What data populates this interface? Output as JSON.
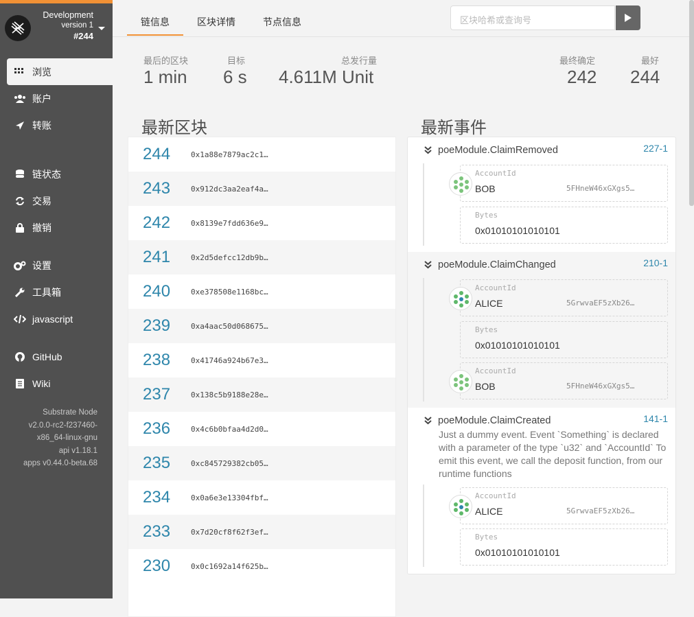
{
  "sidebar": {
    "chain_name": "Development",
    "version": "version 1",
    "block": "#244",
    "items": [
      {
        "label": "浏览",
        "icon": "th-icon"
      },
      {
        "label": "账户",
        "icon": "users-icon"
      },
      {
        "label": "转账",
        "icon": "send-icon"
      },
      {
        "label": "链状态",
        "icon": "database-icon"
      },
      {
        "label": "交易",
        "icon": "sync-icon"
      },
      {
        "label": "撤销",
        "icon": "lock-icon"
      },
      {
        "label": "设置",
        "icon": "cogs-icon"
      },
      {
        "label": "工具箱",
        "icon": "wrench-icon"
      },
      {
        "label": "javascript",
        "icon": "code-icon"
      },
      {
        "label": "GitHub",
        "icon": "github-icon"
      },
      {
        "label": "Wiki",
        "icon": "book-icon"
      }
    ],
    "footer": [
      "Substrate Node",
      "v2.0.0-rc2-f237460-",
      "x86_64-linux-gnu",
      "api v1.18.1",
      "apps v0.44.0-beta.68"
    ]
  },
  "tabs": [
    "链信息",
    "区块详情",
    "节点信息"
  ],
  "search": {
    "placeholder": "区块哈希或查询号"
  },
  "summary": {
    "last_block_label": "最后的区块",
    "last_block": "1 min",
    "target_label": "目标",
    "target": "6 s",
    "issuance_label": "总发行量",
    "issuance": "4.611M Unit",
    "finalized_label": "最终确定",
    "finalized": "242",
    "best_label": "最好",
    "best": "244"
  },
  "recent_blocks_title": "最新区块",
  "recent_events_title": "最新事件",
  "blocks": [
    {
      "number": "244",
      "hash": "0x1a88e7879ac2c1…"
    },
    {
      "number": "243",
      "hash": "0x912dc3aa2eaf4a…"
    },
    {
      "number": "242",
      "hash": "0x8139e7fdd636e9…"
    },
    {
      "number": "241",
      "hash": "0x2d5defcc12db9b…"
    },
    {
      "number": "240",
      "hash": "0xe378508e1168bc…"
    },
    {
      "number": "239",
      "hash": "0xa4aac50d068675…"
    },
    {
      "number": "238",
      "hash": "0x41746a924b67e3…"
    },
    {
      "number": "237",
      "hash": "0x138c5b9188e28e…"
    },
    {
      "number": "236",
      "hash": "0x4c6b0bfaa4d2d0…"
    },
    {
      "number": "235",
      "hash": "0xc845729382cb05…"
    },
    {
      "number": "234",
      "hash": "0x0a6e3e13304fbf…"
    },
    {
      "number": "233",
      "hash": "0x7d20cf8f62f3ef…"
    },
    {
      "number": "230",
      "hash": "0x0c1692a14f625b…"
    }
  ],
  "events": [
    {
      "name": "poeModule.ClaimRemoved",
      "id": "227-1",
      "params": [
        {
          "label": "AccountId",
          "value": "BOB",
          "address": "5FHneW46xGXgs5…"
        },
        {
          "label": "Bytes",
          "value": "0x01010101010101"
        }
      ]
    },
    {
      "name": "poeModule.ClaimChanged",
      "id": "210-1",
      "params": [
        {
          "label": "AccountId",
          "value": "ALICE",
          "address": "5GrwvaEF5zXb26…"
        },
        {
          "label": "Bytes",
          "value": "0x01010101010101"
        },
        {
          "label": "AccountId",
          "value": "BOB",
          "address": "5FHneW46xGXgs5…"
        }
      ]
    },
    {
      "name": "poeModule.ClaimCreated",
      "id": "141-1",
      "description": "Just a dummy event. Event `Something` is declared with a parameter of the type `u32` and `AccountId` To emit this event, we call the deposit function, from our runtime functions",
      "params": [
        {
          "label": "AccountId",
          "value": "ALICE",
          "address": "5GrwvaEF5zXb26…"
        },
        {
          "label": "Bytes",
          "value": "0x01010101010101"
        }
      ]
    }
  ],
  "colors": {
    "accent": "#f19135",
    "link": "#2e86ab",
    "sidebar": "#505050"
  }
}
